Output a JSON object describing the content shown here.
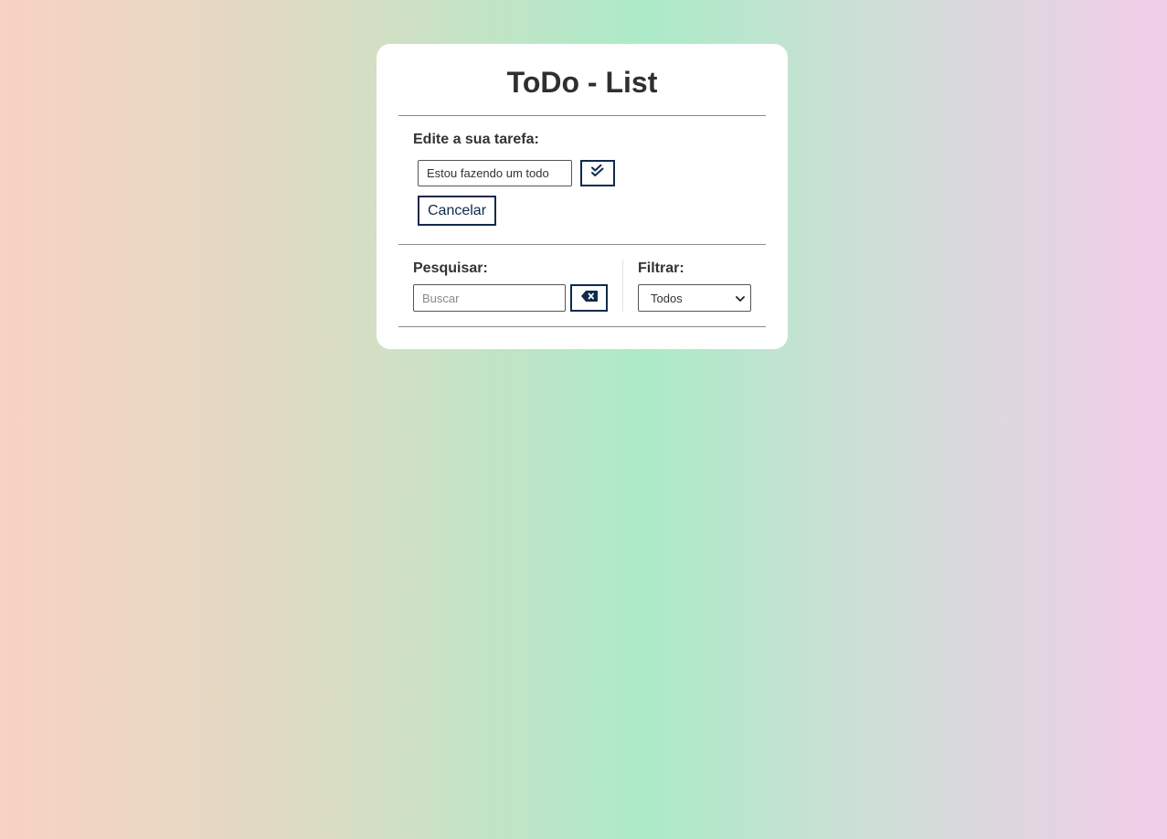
{
  "app": {
    "title": "ToDo - List"
  },
  "edit": {
    "label": "Edite a sua tarefa:",
    "input_value": "Estou fazendo um todo",
    "confirm_icon": "double-check-icon",
    "cancel_label": "Cancelar"
  },
  "search": {
    "label": "Pesquisar:",
    "placeholder": "Buscar",
    "clear_icon": "backspace-icon"
  },
  "filter": {
    "label": "Filtrar:",
    "selected": "Todos"
  },
  "colors": {
    "accent": "#102a4c",
    "card": "#ffffff",
    "text": "#2f2f2f"
  }
}
